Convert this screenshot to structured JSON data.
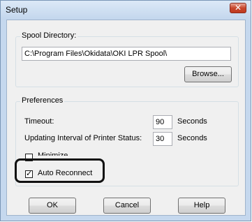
{
  "window": {
    "title": "Setup",
    "close_glyph": "✕"
  },
  "spool": {
    "legend": "Spool Directory:",
    "path": "C:\\Program Files\\Okidata\\OKI LPR Spool\\",
    "browse_label": "Browse..."
  },
  "preferences": {
    "legend": "Preferences",
    "timeout_label": "Timeout:",
    "timeout_value": "90",
    "timeout_unit": "Seconds",
    "interval_label": "Updating Interval of Printer Status:",
    "interval_value": "30",
    "interval_unit": "Seconds",
    "minimize_label": "Minimize",
    "minimize_checked": false,
    "auto_reconnect_label": "Auto Reconnect",
    "auto_reconnect_checked": true,
    "check_glyph": "✓"
  },
  "buttons": {
    "ok": "OK",
    "cancel": "Cancel",
    "help": "Help"
  },
  "colors": {
    "window_frame": "#c5d8ee",
    "close_button": "#c7462c",
    "dialog_face": "#f0f0f0"
  }
}
